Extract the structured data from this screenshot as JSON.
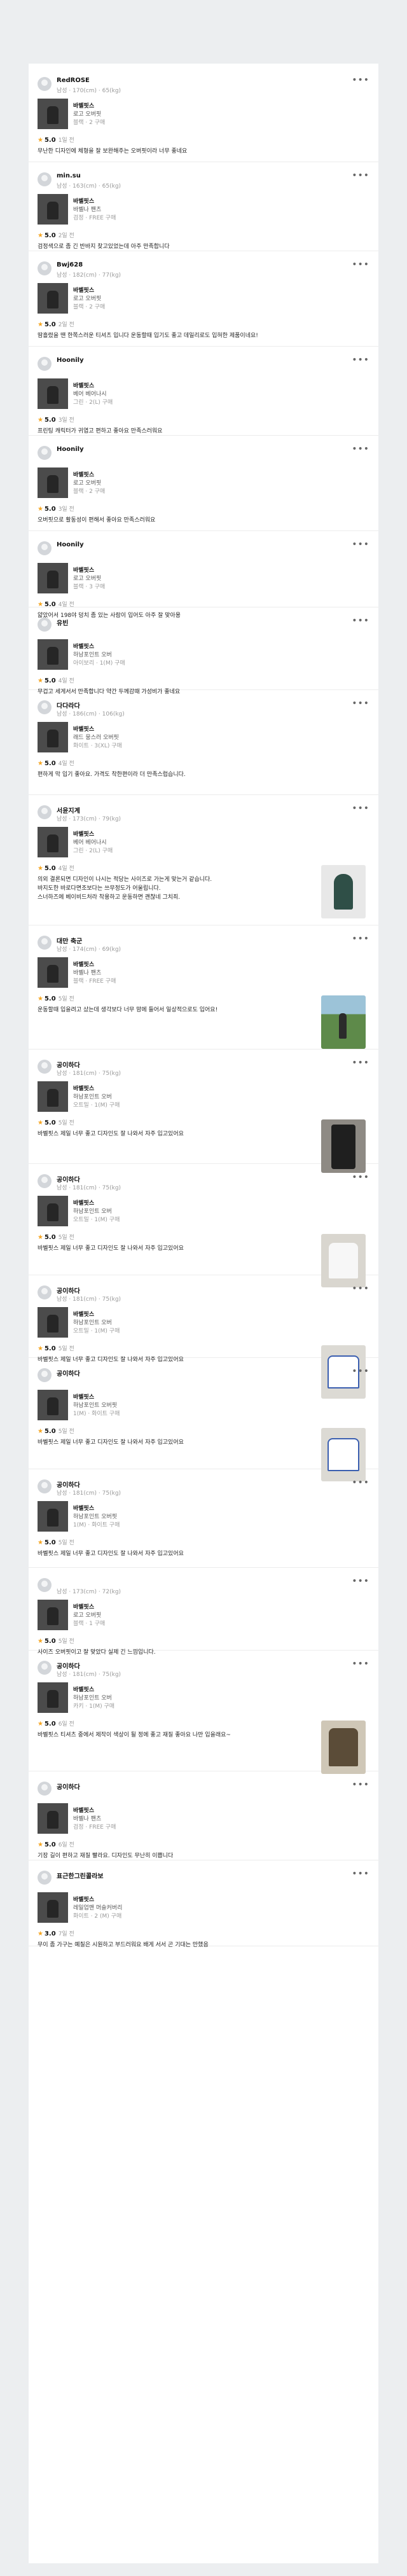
{
  "colors": {
    "star": "#f5a623",
    "page_bg": "#eceef0"
  },
  "icons": {
    "more": "more-horizontal-icon",
    "star": "star-icon"
  },
  "reviews": [
    {
      "user": "RedROSE",
      "specs": "남성 · 170(cm) · 65(kg)",
      "brand": "바벨핏스",
      "product": "로고 오버핏",
      "option": "블랙 · 2 구매",
      "score": "5.0",
      "date": "1일 전",
      "text": "무난한 디자인에 체형을 잘 보완해주는 오버핏이라 너무 좋네요"
    },
    {
      "user": "min.su",
      "specs": "남성 · 163(cm) · 65(kg)",
      "brand": "바벨핏스",
      "product": "바벨나 팬츠",
      "option": "검정 · FREE 구매",
      "score": "5.0",
      "date": "2일 전",
      "text": "검정색으로 좀 긴 반바지 찾고있었는데 아주 만족합니다"
    },
    {
      "user": "Bwj628",
      "specs": "남성 · 182(cm) · 77(kg)",
      "brand": "바벨핏스",
      "product": "로고 오버핏",
      "option": "블랙 · 2 구매",
      "score": "5.0",
      "date": "2일 전",
      "text": "땀흘렸을 땐 한쪽스러운 티셔츠 입니다 운동할때 입기도 좋고 데일리로도 입혀한 제품이네요!"
    },
    {
      "user": "Hoonily",
      "specs": "",
      "brand": "바벨핏스",
      "product": "베어 베어나시",
      "option": "그린 · 2(L) 구매",
      "score": "5.0",
      "date": "3일 전",
      "text": "프린팅 캐릭터가 귀엽고 편하고 좋아요 만족스러워요"
    },
    {
      "user": "Hoonily",
      "specs": "",
      "brand": "바벨핏스",
      "product": "로고 오버핏",
      "option": "블랙 · 2 구매",
      "score": "5.0",
      "date": "3일 전",
      "text": "오버핏으로 활동성이 편해서 좋아요 만족스러워요"
    },
    {
      "user": "Hoonily",
      "specs": "",
      "brand": "바벨핏스",
      "product": "로고 오버핏",
      "option": "블랙 · 3 구매",
      "score": "5.0",
      "date": "4일 전",
      "text": "얇았어서 198야 덩치 좀 있는 사람이 입어도 아주 잘 맞아용"
    },
    {
      "user": "유빈",
      "specs": "",
      "brand": "바벨핏스",
      "product": "하남포인트 오버",
      "option": "아이보리 · 1(M) 구매",
      "score": "5.0",
      "date": "4일 전",
      "text": "무겁고 세게서서 만족합니다 약간 두께감때 가성비가 좋네요"
    },
    {
      "user": "다다라다",
      "specs": "남성 · 186(cm) · 106(kg)",
      "brand": "바벨핏스",
      "product": "래드 뭉스러 오버핏",
      "option": "화이트 · 3(XL) 구매",
      "score": "5.0",
      "date": "4일 전",
      "text": "편하게 막 입기 좋아요. 가격도 착한편이라 더 만족스럽습니다."
    },
    {
      "user": "서윤지계",
      "specs": "남성 · 173(cm) · 79(kg)",
      "brand": "바벨핏스",
      "product": "베어 베어나시",
      "option": "그린 · 2(L) 구매",
      "score": "5.0",
      "date": "4일 전",
      "text": "의외 결론되면 디자인이 나시는 적당는 사이즈로 가는게 맞는거 같습니다.\n바지도한 바로다면조보다는 쓰무정도가 어울립니다.\n스너하즈에 베이비드처라 착용하고 운동하면 괜찮네 그치죄."
    },
    {
      "user": "대만 축군",
      "specs": "남성 · 174(cm) · 69(kg)",
      "brand": "바벨핏스",
      "product": "바벨나 팬츠",
      "option": "블랙 · FREE 구매",
      "score": "5.0",
      "date": "5일 전",
      "text": "운동할때 입을려고 샀는데 생각보다 너무 맘에 들어서 일상적으로도 입어요!"
    },
    {
      "user": "공이하다",
      "specs": "남성 · 181(cm) · 75(kg)",
      "brand": "바벨핏스",
      "product": "하남포인트 오버",
      "option": "오트밀 · 1(M) 구매",
      "score": "5.0",
      "date": "5일 전",
      "text": "바벨핏스 제일 너무 좋고 디자인도 잘 나와서 자주 입고있어요"
    },
    {
      "user": "공이하다",
      "specs": "남성 · 181(cm) · 75(kg)",
      "brand": "바벨핏스",
      "product": "하남포인트 오버",
      "option": "오트밀 · 1(M) 구매",
      "score": "5.0",
      "date": "5일 전",
      "text": "바벨핏스 제일 너무 좋고 디자인도 잘 나와서 자주 입고있어요"
    },
    {
      "user": "공이하다",
      "specs": "남성 · 181(cm) · 75(kg)",
      "brand": "바벨핏스",
      "product": "하남포인트 오버",
      "option": "오트밀 · 1(M) 구매",
      "score": "5.0",
      "date": "5일 전",
      "text": "바벨핏스 제일 너무 좋고 디자인도 잘 나와서 자주 입고있어요"
    },
    {
      "user": "공이하다",
      "specs": "",
      "brand": "바벨핏스",
      "product": "하남포인트 오버핏",
      "option": "1(M) · 화이트 구매",
      "score": "5.0",
      "date": "5일 전",
      "text": "바벨핏스 제일 너무 좋고 디자인도 잘 나와서 자주 입고있어요"
    },
    {
      "user": "공이하다",
      "specs": "남성 · 181(cm) · 75(kg)",
      "brand": "바벨핏스",
      "product": "하남포인트 오버핏",
      "option": "1(M) · 화이트 구매",
      "score": "5.0",
      "date": "5일 전",
      "text": "바벨핏스 제일 너무 좋고 디자인도 잘 나와서 자주 입고있어요"
    },
    {
      "user": "",
      "specs": "남성 · 173(cm) · 72(kg)",
      "brand": "바벨핏스",
      "product": "로고 오버핏",
      "option": "블랙 · 1 구매",
      "score": "5.0",
      "date": "5일 전",
      "text": "사이즈 오버핏이고 잘 맞았다 실제 긴 느낌입니다."
    },
    {
      "user": "공이하다",
      "specs": "남성 · 181(cm) · 75(kg)",
      "brand": "바벨핏스",
      "product": "하남포인트 오버",
      "option": "카키 · 1(M) 구매",
      "score": "5.0",
      "date": "6일 전",
      "text": "바벨핏스 티셔츠 중에서 제작이 색상이 될 정에 좋고 재질 좋아요 나만 입을래요~"
    },
    {
      "user": "공이하다",
      "specs": "",
      "brand": "바벨핏스",
      "product": "바벨나 팬츠",
      "option": "검정 · FREE 구매",
      "score": "5.0",
      "date": "6일 전",
      "text": "기장 길이 편하고 재질 빨라요. 디자인도 무난히 이쁩니다"
    },
    {
      "user": "표근한그린콜라보",
      "specs": "",
      "brand": "바벨핏스",
      "product": "레일업맨 머슬커버리",
      "option": "화이트 · 2 (M) 구매",
      "score": "3.0",
      "date": "7일 전",
      "text": "무이 좀 가구는 예칠은 시원하고 부드러워요 배게 서서 곤 기대는 만했음"
    }
  ],
  "standalone_header": {
    "user": "공이하다"
  }
}
